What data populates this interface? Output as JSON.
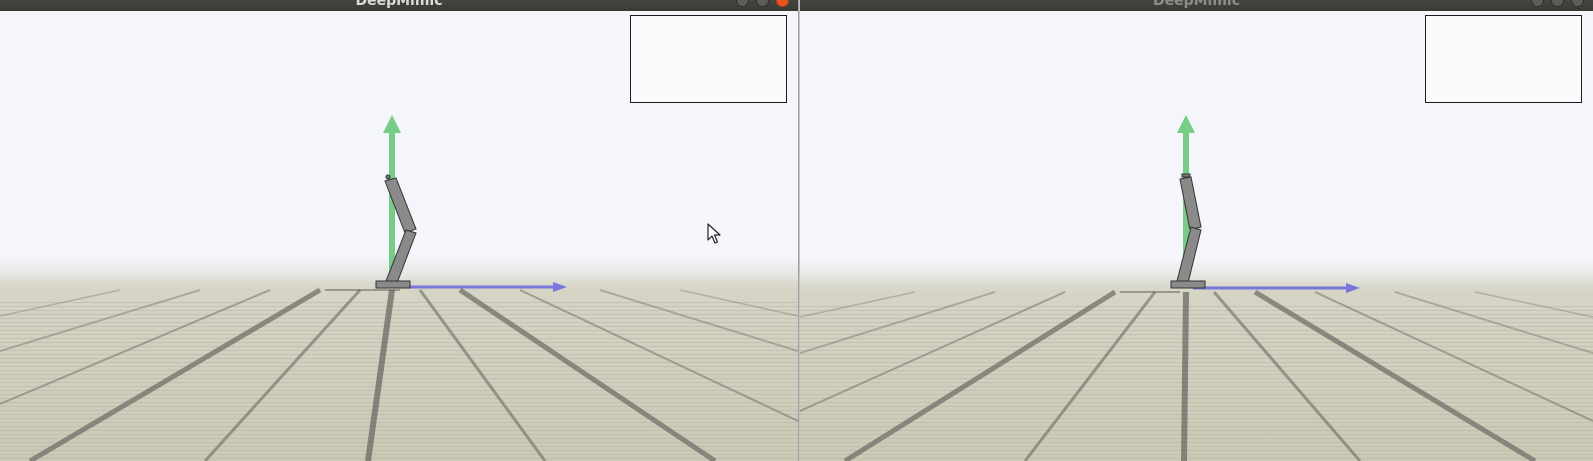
{
  "windows": [
    {
      "title": "DeepMimic",
      "focused": true,
      "titlebar_buttons": [
        "minimize-icon",
        "maximize-icon",
        "close-icon"
      ]
    },
    {
      "title": "DeepMimic",
      "focused": false,
      "titlebar_buttons": [
        "minimize-icon",
        "maximize-icon",
        "close-icon"
      ]
    }
  ],
  "colors": {
    "sky": "#f4f6fb",
    "floor": "#cfcdbb",
    "floor_line": "#5f5f5a",
    "up_axis_arrow": "#77cc88",
    "forward_axis_arrow": "#7777dd",
    "character_body": "#8a8a8a",
    "close_button_active": "#e95420",
    "titlebar": "#3e3e39"
  },
  "icons": {
    "cursor": "mouse-pointer-icon"
  }
}
